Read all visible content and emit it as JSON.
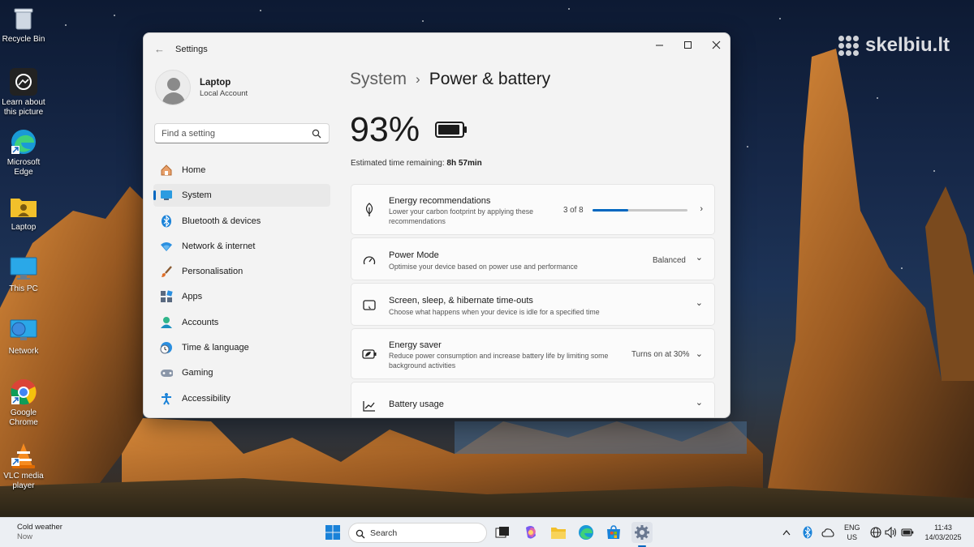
{
  "desktop": {
    "watermark": "skelbiu.lt",
    "icons": [
      {
        "label": "Recycle Bin"
      },
      {
        "label": "Learn about this picture"
      },
      {
        "label": "Microsoft Edge"
      },
      {
        "label": "Laptop"
      },
      {
        "label": "This PC"
      },
      {
        "label": "Network"
      },
      {
        "label": "Google Chrome"
      },
      {
        "label": "VLC media player"
      }
    ]
  },
  "window": {
    "title": "Settings",
    "profile": {
      "name": "Laptop",
      "account": "Local Account"
    },
    "search": {
      "placeholder": "Find a setting"
    },
    "nav": [
      {
        "label": "Home",
        "icon": "home-icon"
      },
      {
        "label": "System",
        "icon": "system-icon",
        "active": true
      },
      {
        "label": "Bluetooth & devices",
        "icon": "bluetooth-icon"
      },
      {
        "label": "Network & internet",
        "icon": "wifi-icon"
      },
      {
        "label": "Personalisation",
        "icon": "brush-icon"
      },
      {
        "label": "Apps",
        "icon": "apps-icon"
      },
      {
        "label": "Accounts",
        "icon": "accounts-icon"
      },
      {
        "label": "Time & language",
        "icon": "globe-clock-icon"
      },
      {
        "label": "Gaming",
        "icon": "gamepad-icon"
      },
      {
        "label": "Accessibility",
        "icon": "accessibility-icon"
      }
    ],
    "breadcrumb": {
      "parent": "System",
      "separator": "›",
      "current": "Power & battery"
    },
    "battery": {
      "percent": "93%",
      "level": 0.93,
      "estimate_label": "Estimated time remaining:",
      "estimate_value": "8h 57min"
    },
    "cards": [
      {
        "title": "Energy recommendations",
        "subtitle": "Lower your carbon footprint by applying these recommendations",
        "right": "3 of 8",
        "progress": 0.375,
        "chevron": "›"
      },
      {
        "title": "Power Mode",
        "subtitle": "Optimise your device based on power use and performance",
        "right": "Balanced",
        "chevron": "⌄"
      },
      {
        "title": "Screen, sleep, & hibernate time-outs",
        "subtitle": "Choose what happens when your device is idle for a specified time",
        "right": "",
        "chevron": "⌄"
      },
      {
        "title": "Energy saver",
        "subtitle": "Reduce power consumption and increase battery life by limiting some background activities",
        "right": "Turns on at 30%",
        "chevron": "⌄"
      },
      {
        "title": "Battery usage",
        "subtitle": "",
        "right": "",
        "chevron": "⌄"
      }
    ]
  },
  "taskbar": {
    "weather": {
      "title": "Cold weather",
      "sub": "Now"
    },
    "search_placeholder": "Search",
    "lang": {
      "top": "ENG",
      "bottom": "US"
    },
    "clock": {
      "time": "11:43",
      "date": "14/03/2025"
    }
  },
  "colors": {
    "accent": "#0067c0",
    "window_bg": "#f3f3f3",
    "card_bg": "#fbfbfb",
    "taskbar_bg": "#eceff3"
  }
}
